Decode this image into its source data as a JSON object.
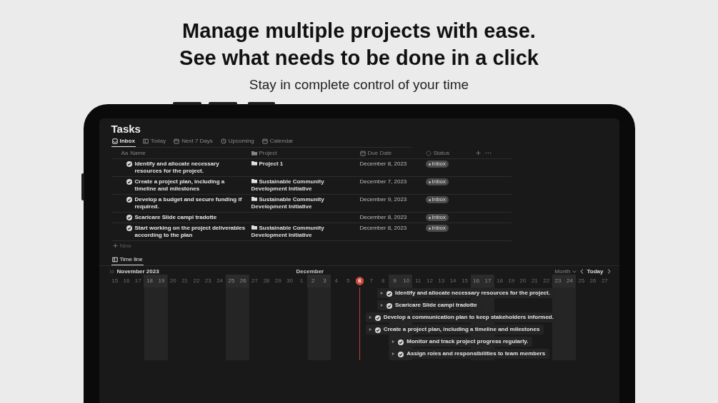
{
  "headline": [
    "Manage multiple projects with ease.",
    "See what needs to be done in a click"
  ],
  "subtitle": "Stay in complete control of your time",
  "app": {
    "title": "Tasks",
    "views": [
      {
        "label": "Inbox",
        "selected": true
      },
      {
        "label": "Today",
        "selected": false
      },
      {
        "label": "Next 7 Days",
        "selected": false
      },
      {
        "label": "Upcoming",
        "selected": false
      },
      {
        "label": "Calendar",
        "selected": false
      }
    ],
    "table": {
      "columns": [
        {
          "label": "Name",
          "prefix": "Aa",
          "kind": "title"
        },
        {
          "label": "Project",
          "kind": "project"
        },
        {
          "label": "Due Date",
          "kind": "date"
        },
        {
          "label": "Status",
          "kind": "status"
        }
      ],
      "rows": [
        {
          "name": "Identify and allocate necessary resources for the project.",
          "project": "Project 1",
          "due": "December 8, 2023",
          "status": "Inbox"
        },
        {
          "name": "Create a project plan, including a timeline and milestones",
          "project": "Sustainable Community Development Initiative",
          "due": "December 7, 2023",
          "status": "Inbox"
        },
        {
          "name": "Develop a budget and secure funding if required.",
          "project": "Sustainable Community Development Initiative",
          "due": "December 9, 2023",
          "status": "Inbox"
        },
        {
          "name": "Scaricare Slide campi tradotte",
          "due": "December 8, 2023",
          "status": "Inbox"
        },
        {
          "name": "Start working on the project deliverables according to the plan",
          "project": "Sustainable Community Development Initiative",
          "due": "December 8, 2023",
          "status": "Inbox"
        }
      ],
      "new_label": "New"
    },
    "timeline": {
      "tab": {
        "label": "Time line",
        "selected": true
      },
      "month_left": "November 2023",
      "month_right": "December",
      "scale": "Month",
      "today_button": "Today",
      "days": [
        {
          "label": "15",
          "weekend": false,
          "today": false
        },
        {
          "label": "16",
          "weekend": false,
          "today": false
        },
        {
          "label": "17",
          "weekend": false,
          "today": false
        },
        {
          "label": "18",
          "weekend": true,
          "today": false
        },
        {
          "label": "19",
          "weekend": true,
          "today": false
        },
        {
          "label": "20",
          "weekend": false,
          "today": false
        },
        {
          "label": "21",
          "weekend": false,
          "today": false
        },
        {
          "label": "22",
          "weekend": false,
          "today": false
        },
        {
          "label": "23",
          "weekend": false,
          "today": false
        },
        {
          "label": "24",
          "weekend": false,
          "today": false
        },
        {
          "label": "25",
          "weekend": true,
          "today": false
        },
        {
          "label": "26",
          "weekend": true,
          "today": false
        },
        {
          "label": "27",
          "weekend": false,
          "today": false
        },
        {
          "label": "28",
          "weekend": false,
          "today": false
        },
        {
          "label": "29",
          "weekend": false,
          "today": false
        },
        {
          "label": "30",
          "weekend": false,
          "today": false
        },
        {
          "label": "1",
          "weekend": false,
          "today": false
        },
        {
          "label": "2",
          "weekend": true,
          "today": false
        },
        {
          "label": "3",
          "weekend": true,
          "today": false
        },
        {
          "label": "4",
          "weekend": false,
          "today": false
        },
        {
          "label": "5",
          "weekend": false,
          "today": false
        },
        {
          "label": "6",
          "weekend": false,
          "today": true
        },
        {
          "label": "7",
          "weekend": false,
          "today": false
        },
        {
          "label": "8",
          "weekend": false,
          "today": false
        },
        {
          "label": "9",
          "weekend": true,
          "today": false
        },
        {
          "label": "10",
          "weekend": true,
          "today": false
        },
        {
          "label": "11",
          "weekend": false,
          "today": false
        },
        {
          "label": "12",
          "weekend": false,
          "today": false
        },
        {
          "label": "13",
          "weekend": false,
          "today": false
        },
        {
          "label": "14",
          "weekend": false,
          "today": false
        },
        {
          "label": "15",
          "weekend": false,
          "today": false
        },
        {
          "label": "16",
          "weekend": true,
          "today": false
        },
        {
          "label": "17",
          "weekend": true,
          "today": false
        },
        {
          "label": "18",
          "weekend": false,
          "today": false
        },
        {
          "label": "19",
          "weekend": false,
          "today": false
        },
        {
          "label": "20",
          "weekend": false,
          "today": false
        },
        {
          "label": "21",
          "weekend": false,
          "today": false
        },
        {
          "label": "22",
          "weekend": false,
          "today": false
        },
        {
          "label": "23",
          "weekend": true,
          "today": false
        },
        {
          "label": "24",
          "weekend": true,
          "today": false
        },
        {
          "label": "25",
          "weekend": false,
          "today": false
        },
        {
          "label": "26",
          "weekend": false,
          "today": false
        },
        {
          "label": "27",
          "weekend": false,
          "today": false
        }
      ],
      "items": [
        {
          "name": "Identify and allocate necessary resources for the project."
        },
        {
          "name": "Scaricare Slide campi tradotte"
        },
        {
          "name": "Develop a communication plan to keep stakeholders informed."
        },
        {
          "name": "Create a project plan, including a timeline and milestones"
        },
        {
          "name": "Monitor and track project progress regularly."
        },
        {
          "name": "Assign roles and responsibilities to team members"
        }
      ]
    }
  }
}
